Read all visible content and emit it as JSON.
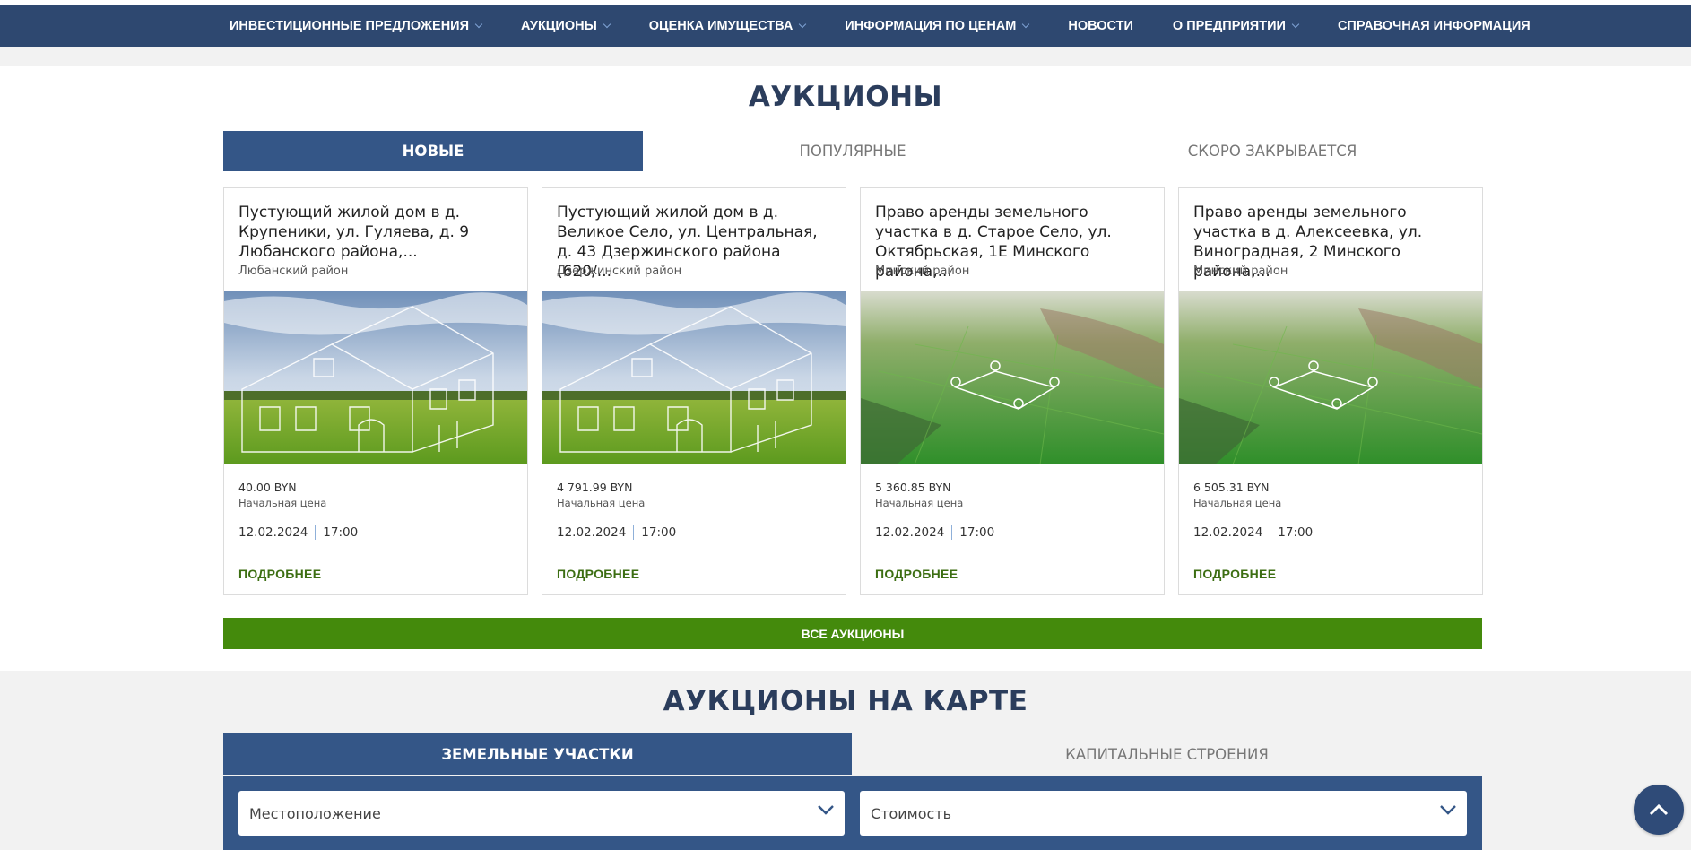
{
  "nav": {
    "items": [
      {
        "label": "ИНВЕСТИЦИОННЫЕ ПРЕДЛОЖЕНИЯ",
        "dropdown": true
      },
      {
        "label": "АУКЦИОНЫ",
        "dropdown": true
      },
      {
        "label": "ОЦЕНКА ИМУЩЕСТВА",
        "dropdown": true
      },
      {
        "label": "ИНФОРМАЦИЯ ПО ЦЕНАМ",
        "dropdown": true
      },
      {
        "label": "НОВОСТИ",
        "dropdown": false
      },
      {
        "label": "О ПРЕДПРИЯТИИ",
        "dropdown": true
      },
      {
        "label": "СПРАВОЧНАЯ ИНФОРМАЦИЯ",
        "dropdown": false
      }
    ]
  },
  "auctions": {
    "title": "АУКЦИОНЫ",
    "tabs": [
      {
        "label": "НОВЫЕ",
        "active": true
      },
      {
        "label": "ПОПУЛЯРНЫЕ",
        "active": false
      },
      {
        "label": "СКОРО ЗАКРЫВАЕТСЯ",
        "active": false
      }
    ],
    "cards": [
      {
        "title": "Пустующий жилой дом в д. Крупеники, ул. Гуляева, д. 9 Любанского района,...",
        "district": "Любанский район",
        "image": "house-field",
        "price": "40.00 BYN",
        "price_label": "Начальная цена",
        "date": "12.02.2024",
        "time": "17:00",
        "more": "ПОДРОБНЕЕ"
      },
      {
        "title": "Пустующий жилой дом в д. Великое Село, ул. Центральная, д. 43 Дзержинского района (620/...",
        "district": "Дзержинский район",
        "image": "house-field",
        "price": "4 791.99 BYN",
        "price_label": "Начальная цена",
        "date": "12.02.2024",
        "time": "17:00",
        "more": "ПОДРОБНЕЕ"
      },
      {
        "title": "Право аренды земельного участка в д. Старое Село, ул. Октябрьская, 1Е Минского района,...",
        "district": "Минский район",
        "image": "land-plot",
        "price": "5 360.85 BYN",
        "price_label": "Начальная цена",
        "date": "12.02.2024",
        "time": "17:00",
        "more": "ПОДРОБНЕЕ"
      },
      {
        "title": "Право аренды земельного участка в д. Алексеевка, ул. Виноградная, 2 Минского района,...",
        "district": "Минский район",
        "image": "land-plot",
        "price": "6 505.31 BYN",
        "price_label": "Начальная цена",
        "date": "12.02.2024",
        "time": "17:00",
        "more": "ПОДРОБНЕЕ"
      }
    ],
    "all_button": "ВСЕ АУКЦИОНЫ"
  },
  "map": {
    "title": "АУКЦИОНЫ НА КАРТЕ",
    "tabs": [
      {
        "label": "ЗЕМЕЛЬНЫЕ УЧАСТКИ",
        "active": true
      },
      {
        "label": "КАПИТАЛЬНЫЕ СТРОЕНИЯ",
        "active": false
      }
    ],
    "filters": {
      "location": "Местоположение",
      "price": "Стоимость"
    }
  },
  "scroll_top": {
    "icon": "chevron-up-icon"
  },
  "colors": {
    "nav_bg": "#2e4870",
    "tab_active": "#345687",
    "accent_green": "#448a0c",
    "link_green": "#3c6e12"
  }
}
